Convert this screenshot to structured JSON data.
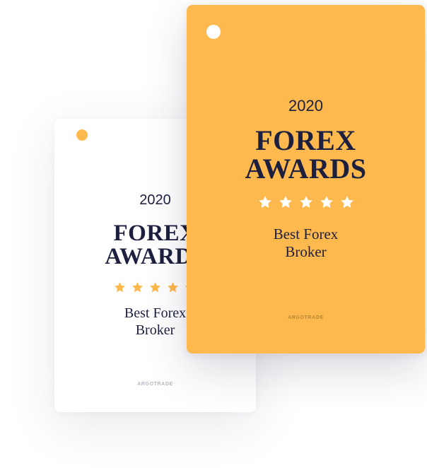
{
  "colors": {
    "accent": "#fdb94d",
    "text": "#1d1f3f",
    "card_back": "#ffffff",
    "star_on_white": "#fdb94d",
    "star_on_orange": "#ffffff"
  },
  "back_card": {
    "year": "2020",
    "title_line1": "FOREX",
    "title_line2": "AWARDS",
    "rating": 5,
    "subtitle_line1": "Best Forex",
    "subtitle_line2": "Broker",
    "brand": "ARGOTRADE"
  },
  "front_card": {
    "year": "2020",
    "title_line1": "FOREX",
    "title_line2": "AWARDS",
    "rating": 5,
    "subtitle_line1": "Best Forex",
    "subtitle_line2": "Broker",
    "brand": "ARGOTRADE"
  }
}
